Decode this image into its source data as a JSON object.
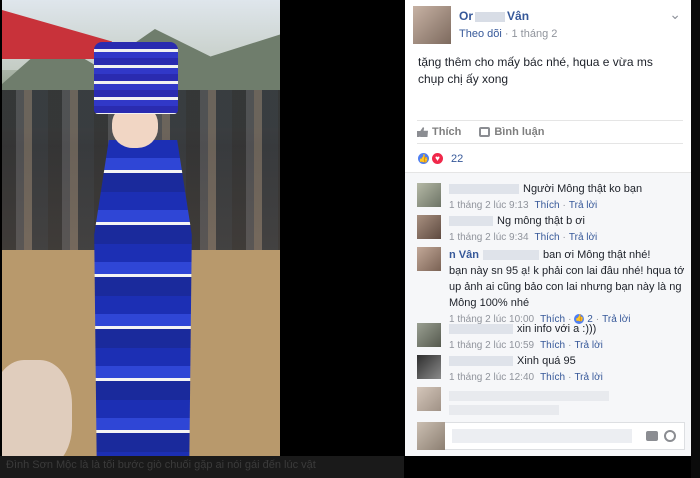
{
  "post": {
    "author_visible": "Or",
    "author_visible_end": "Vân",
    "follow_label": "Theo dõi",
    "date": "1 tháng 2",
    "text": "tặng thêm cho mấy bác nhé, hqua e vừa ms chụp chị ấy xong"
  },
  "actions": {
    "like": "Thích",
    "comment": "Bình luận"
  },
  "reactions": {
    "count": "22"
  },
  "comments": [
    {
      "text": "Người Mông thật ko bạn",
      "time": "1 tháng 2 lúc 9:13",
      "like": "Thích",
      "reply": "Trả lời"
    },
    {
      "text": "Ng mông thật b ơi",
      "time": "1 tháng 2 lúc 9:34",
      "like": "Thích",
      "reply": "Trả lời"
    },
    {
      "name_visible": "n Vân",
      "text_start": "ban ơi Mông thật nhé!",
      "text": "bạn này sn 95 ạ! k phải con lai đâu nhé! hqua tớ up ảnh ai cũng bảo con lai nhưng bạn này là ng Mông 100% nhé",
      "time": "1 tháng 2 lúc 10:00",
      "like": "Thích",
      "likes": "2",
      "reply": "Trả lời"
    },
    {
      "text": "xin info với a :)))",
      "time": "1 tháng 2 lúc 10:59",
      "like": "Thích",
      "reply": "Trả lời"
    },
    {
      "text": "Xinh quá 95",
      "time": "1 tháng 2 lúc 12:40",
      "like": "Thích",
      "reply": "Trả lời"
    }
  ],
  "caption": "Đình Sơn  Mộc là là tối bước giò chuối gặp ai nói gái đến lúc vật cả !!"
}
